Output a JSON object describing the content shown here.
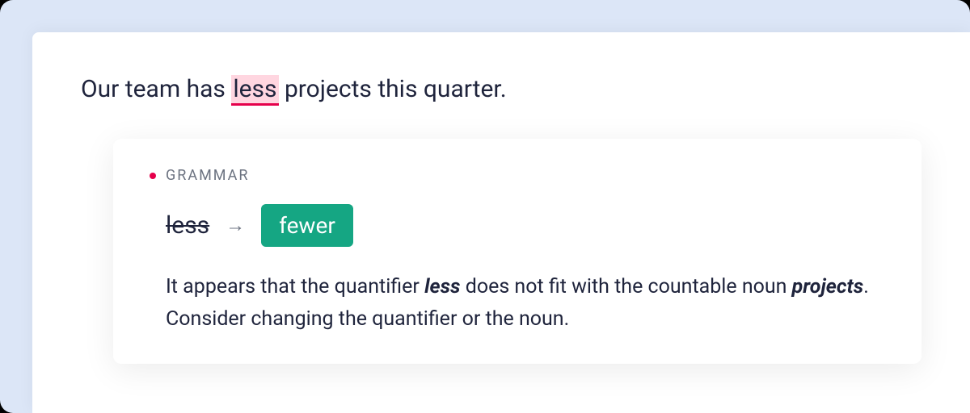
{
  "sentence": {
    "before": "Our team has ",
    "highlighted": "less",
    "after": " projects this quarter."
  },
  "suggestion": {
    "category": "GRAMMAR",
    "original": "less",
    "replacement": "fewer",
    "explanation": {
      "part1": "It appears that the quantifier ",
      "em1": "less",
      "part2": " does not fit with the countable noun ",
      "em2": "projects",
      "part3": ". Consider changing the quantifier or the noun."
    }
  },
  "colors": {
    "error": "#e5004b",
    "highlight_bg": "#ffd6e0",
    "suggestion_bg": "#15a683",
    "outer_bg": "#dce6f7"
  }
}
